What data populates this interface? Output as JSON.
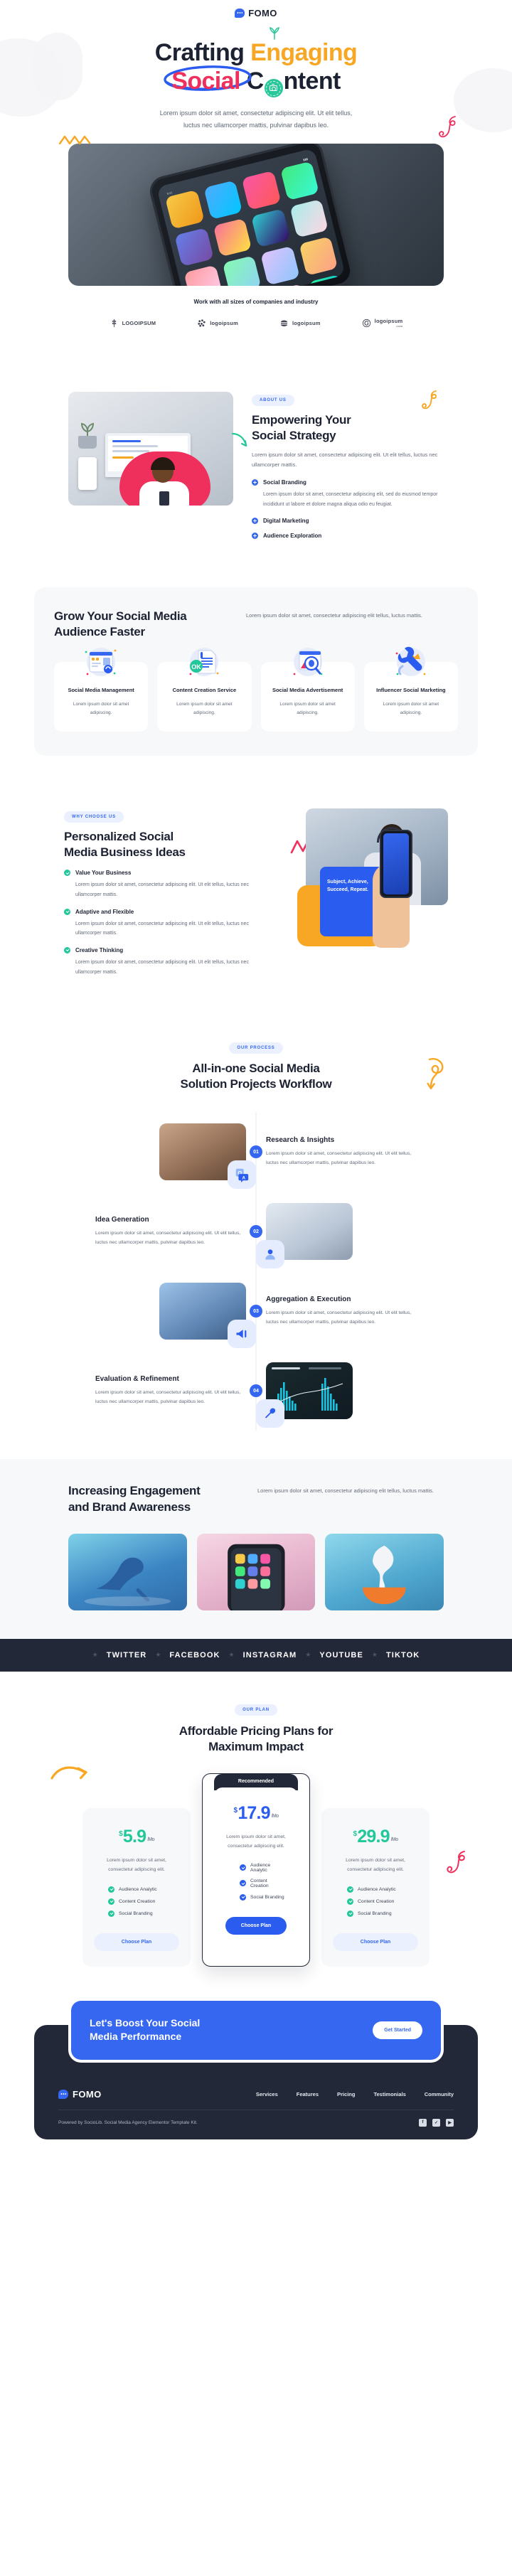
{
  "brand": {
    "name": "FOMO",
    "accent": "#3567f0",
    "dark": "#222838",
    "green": "#22c79a",
    "orange": "#f8a725",
    "pink": "#f0305c"
  },
  "hero": {
    "title_part1": "Crafting ",
    "title_engaging": "Engaging",
    "title_social": "Social",
    "title_c": "C",
    "title_ontent": "ntent",
    "subtitle_line1": "Lorem ipsum dolor sit amet, consectetur adipiscing elit. Ut elit tellus,",
    "subtitle_line2": "luctus nec ullamcorper mattis, pulvinar dapibus leo.",
    "photo_caption": "Work with all sizes of companies and industry"
  },
  "logos": [
    {
      "name": "LOGOIPSUM",
      "style": "wheat"
    },
    {
      "name": "logoipsum",
      "style": "dots"
    },
    {
      "name": "logoipsum",
      "style": "burger"
    },
    {
      "name": "logoipsum",
      "style": "spiral",
      "tld": ".com"
    }
  ],
  "about": {
    "badge": "ABOUT US",
    "title_line1": "Empowering Your",
    "title_line2": "Social Strategy",
    "intro": "Lorem ipsum dolor sit amet, consectetur adipiscing elit. Ut elit tellus, luctus nec ullamcorper mattis.",
    "features": [
      {
        "title": "Social Branding",
        "body": "Lorem ipsum dolor sit amet, consectetur adipiscing elit, sed do eiusmod tempor incididunt ut labore et dolore magna aliqua odio eu feugiat."
      },
      {
        "title": "Digital Marketing",
        "body": ""
      },
      {
        "title": "Audience Exploration",
        "body": ""
      }
    ]
  },
  "services": {
    "title_line1": "Grow Your Social Media",
    "title_line2": "Audience Faster",
    "subtitle": "Lorem ipsum dolor sit amet, consectetur adipiscing elit tellus, luctus mattis.",
    "cards": [
      {
        "title": "Social Media Management",
        "desc": "Lorem ipsum dolor sit amet adipiscing.",
        "icon": "profile-card-icon"
      },
      {
        "title": "Content Creation Service",
        "desc": "Lorem ipsum dolor sit amet adipiscing.",
        "icon": "document-ok-icon"
      },
      {
        "title": "Social Media Advertisement",
        "desc": "Lorem ipsum dolor sit amet adipiscing.",
        "icon": "bug-search-icon"
      },
      {
        "title": "Influencer Social Marketing",
        "desc": "Lorem ipsum dolor sit amet adipiscing.",
        "icon": "wrench-crown-icon"
      }
    ]
  },
  "why": {
    "badge": "WHY CHOOSE US",
    "title_line1": "Personalized Social",
    "title_line2": "Media Business Ideas",
    "card_text": "Subject, Achieve, Succeed, Repeat.",
    "items": [
      {
        "title": "Value Your Business",
        "body": "Lorem ipsum dolor sit amet, consectetur adipiscing elit. Ut elit tellus, luctus nec ullamcorper mattis."
      },
      {
        "title": "Adaptive and Flexible",
        "body": "Lorem ipsum dolor sit amet, consectetur adipiscing elit. Ut elit tellus, luctus nec ullamcorper mattis."
      },
      {
        "title": "Creative Thinking",
        "body": "Lorem ipsum dolor sit amet, consectetur adipiscing elit. Ut elit tellus, luctus nec ullamcorper mattis."
      }
    ]
  },
  "process": {
    "badge": "OUR PROCESS",
    "title_line1": "All-in-one Social Media",
    "title_line2": "Solution Projects Workflow",
    "steps": [
      {
        "num": "01",
        "title": "Research & Insights",
        "body": "Lorem ipsum dolor sit amet, consectetur adipiscing elit. Ut elit tellus, luctus nec ullamcorper mattis, pulvinar dapibus leo.",
        "chip": "qa-translate-icon"
      },
      {
        "num": "02",
        "title": "Idea Generation",
        "body": "Lorem ipsum dolor sit amet, consectetur adipiscing elit. Ut elit tellus, luctus nec ullamcorper mattis, pulvinar dapibus leo.",
        "chip": "user-idea-icon"
      },
      {
        "num": "03",
        "title": "Aggregation & Execution",
        "body": "Lorem ipsum dolor sit amet, consectetur adipiscing elit. Ut elit tellus, luctus nec ullamcorper mattis, pulvinar dapibus leo.",
        "chip": "megaphone-icon"
      },
      {
        "num": "04",
        "title": "Evaluation & Refinement",
        "body": "Lorem ipsum dolor sit amet, consectetur adipiscing elit. Ut elit tellus, luctus nec ullamcorper mattis, pulvinar dapibus leo.",
        "chip": "settings-wrench-icon"
      }
    ]
  },
  "gallery": {
    "title_line1": "Increasing Engagement",
    "title_line2": "and Brand Awareness",
    "subtitle": "Lorem ipsum dolor sit amet, consectetur adipiscing elit tellus, luctus mattis.",
    "items": [
      {
        "alt": "blue-heels-photo"
      },
      {
        "alt": "phone-apps-photo"
      },
      {
        "alt": "white-sculpture-photo"
      }
    ]
  },
  "marquee": {
    "items": [
      "TWITTER",
      "FACEBOOK",
      "INSTAGRAM",
      "YOUTUBE",
      "TIKTOK"
    ],
    "separator": "★"
  },
  "pricing": {
    "badge": "OUR PLAN",
    "title_line1": "Affordable Pricing Plans for",
    "title_line2": "Maximum Impact",
    "recommended_label": "Recommended",
    "plans": [
      {
        "currency": "$",
        "amount": "5.9",
        "period": "/Mo",
        "desc": "Lorem ipsum dolor sit amet, consectetur adipiscing elit.",
        "features": [
          "Audience Analytic",
          "Content Creation",
          "Social Branding"
        ],
        "button": "Choose Plan",
        "featured": false
      },
      {
        "currency": "$",
        "amount": "17.9",
        "period": "/Mo",
        "desc": "Lorem ipsum dolor sit amet, consectetur adipiscing elit.",
        "features": [
          "Audience Analytic",
          "Content Creation",
          "Social Branding"
        ],
        "button": "Choose Plan",
        "featured": true
      },
      {
        "currency": "$",
        "amount": "29.9",
        "period": "/Mo",
        "desc": "Lorem ipsum dolor sit amet, consectetur adipiscing elit.",
        "features": [
          "Audience Analytic",
          "Content Creation",
          "Social Branding"
        ],
        "button": "Choose Plan",
        "featured": false
      }
    ]
  },
  "cta": {
    "title_line1": "Let's Boost Your Social",
    "title_line2": "Media Performance",
    "button": "Get Started"
  },
  "footer": {
    "logo": "FOMO",
    "nav": [
      "Services",
      "Features",
      "Pricing",
      "Testimonials",
      "Community"
    ],
    "copyright": "Powered by SocioLib. Social Media Agency Elementor Template Kit.",
    "socials": [
      {
        "name": "facebook-icon",
        "glyph": "f"
      },
      {
        "name": "twitter-icon",
        "glyph": "✓"
      },
      {
        "name": "youtube-icon",
        "glyph": "▶"
      }
    ]
  }
}
